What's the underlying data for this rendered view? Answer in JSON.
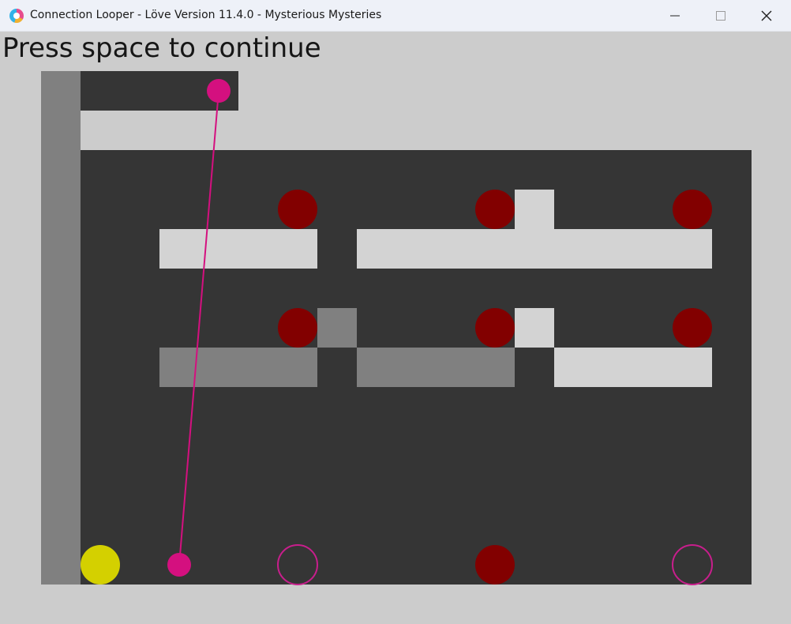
{
  "window": {
    "title": "Connection Looper - Löve Version 11.4.0 - Mysterious Mysteries",
    "icon": "love-heart-icon",
    "controls": {
      "minimize_glyph": "—",
      "maximize_glyph": "☐",
      "close_glyph": "✕"
    }
  },
  "game": {
    "prompt": "Press space to continue",
    "colors": {
      "background": "#cccccc",
      "wall_dark": "#353535",
      "wall_mid": "#808080",
      "wall_light": "#d3d3d3",
      "goal_filled": "#820000",
      "target_ring": "#c81e8c",
      "connector": "#d4107f",
      "player": "#d4d000"
    },
    "legend_of_pieces": {
      "player": "yellow-ball",
      "connector": "magenta-link",
      "goals": "dark-red-discs",
      "targets": "magenta-rings"
    }
  }
}
